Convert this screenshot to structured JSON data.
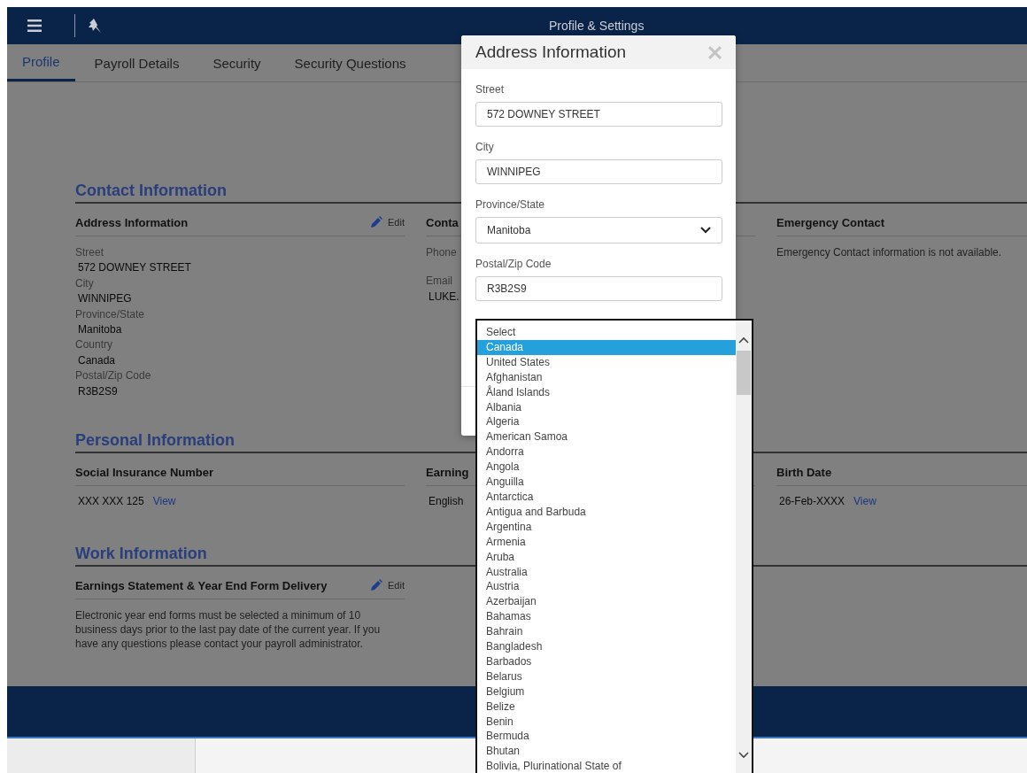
{
  "topbar": {
    "title": "Profile & Settings"
  },
  "tabs": [
    {
      "label": "Profile",
      "selected": true
    },
    {
      "label": "Payroll Details",
      "selected": false
    },
    {
      "label": "Security",
      "selected": false
    },
    {
      "label": "Security Questions",
      "selected": false
    }
  ],
  "sections": [
    {
      "title": "Contact Information",
      "columns": [
        {
          "heading": "Address Information",
          "action": "Edit",
          "fields": [
            {
              "label": "Street",
              "value": "572 DOWNEY STREET"
            },
            {
              "label": "City",
              "value": "WINNIPEG"
            },
            {
              "label": "Province/State",
              "value": "Manitoba"
            },
            {
              "label": "Country",
              "value": "Canada"
            },
            {
              "label": "Postal/Zip Code",
              "value": "R3B2S9"
            }
          ]
        },
        {
          "heading": "Conta",
          "fields": [
            {
              "label": "Phone"
            },
            {
              "label": "Email",
              "value": "LUKE."
            }
          ]
        },
        {
          "heading": "Emergency Contact",
          "text": "Emergency Contact information is not available."
        }
      ]
    },
    {
      "title": "Personal Information",
      "columns": [
        {
          "heading": "Social Insurance Number",
          "value": "XXX XXX 125",
          "link": "View"
        },
        {
          "heading": "Earning",
          "value": "English"
        },
        {
          "heading": "Birth Date",
          "value": "26-Feb-XXXX",
          "link": "View"
        }
      ]
    },
    {
      "title": "Work Information",
      "columns": [
        {
          "heading": "Earnings Statement & Year End Form Delivery",
          "action": "Edit",
          "text": "Electronic year end forms must be selected a minimum of 10 business days prior to the last pay date of the current year. If you have any questions please contact your payroll administrator."
        }
      ]
    }
  ],
  "modal": {
    "title": "Address Information",
    "fields": [
      {
        "kind": "text",
        "label": "Street",
        "value": "572 DOWNEY STREET"
      },
      {
        "kind": "text",
        "label": "City",
        "value": "WINNIPEG"
      },
      {
        "kind": "select",
        "label": "Province/State",
        "value": "Manitoba"
      },
      {
        "kind": "text",
        "label": "Postal/Zip Code",
        "value": "R3B2S9"
      }
    ]
  },
  "dropdown": {
    "options": [
      {
        "label": "Select",
        "selected": false
      },
      {
        "label": "Canada",
        "selected": true
      },
      {
        "label": "United States",
        "selected": false
      },
      {
        "label": "Afghanistan",
        "selected": false
      },
      {
        "label": "Åland Islands",
        "selected": false
      },
      {
        "label": "Albania",
        "selected": false
      },
      {
        "label": "Algeria",
        "selected": false
      },
      {
        "label": "American Samoa",
        "selected": false
      },
      {
        "label": "Andorra",
        "selected": false
      },
      {
        "label": "Angola",
        "selected": false
      },
      {
        "label": "Anguilla",
        "selected": false
      },
      {
        "label": "Antarctica",
        "selected": false
      },
      {
        "label": "Antigua and Barbuda",
        "selected": false
      },
      {
        "label": "Argentina",
        "selected": false
      },
      {
        "label": "Armenia",
        "selected": false
      },
      {
        "label": "Aruba",
        "selected": false
      },
      {
        "label": "Australia",
        "selected": false
      },
      {
        "label": "Austria",
        "selected": false
      },
      {
        "label": "Azerbaijan",
        "selected": false
      },
      {
        "label": "Bahamas",
        "selected": false
      },
      {
        "label": "Bahrain",
        "selected": false
      },
      {
        "label": "Bangladesh",
        "selected": false
      },
      {
        "label": "Barbados",
        "selected": false
      },
      {
        "label": "Belarus",
        "selected": false
      },
      {
        "label": "Belgium",
        "selected": false
      },
      {
        "label": "Belize",
        "selected": false
      },
      {
        "label": "Benin",
        "selected": false
      },
      {
        "label": "Bermuda",
        "selected": false
      },
      {
        "label": "Bhutan",
        "selected": false
      },
      {
        "label": "Bolivia, Plurinational State of",
        "selected": false
      }
    ]
  }
}
